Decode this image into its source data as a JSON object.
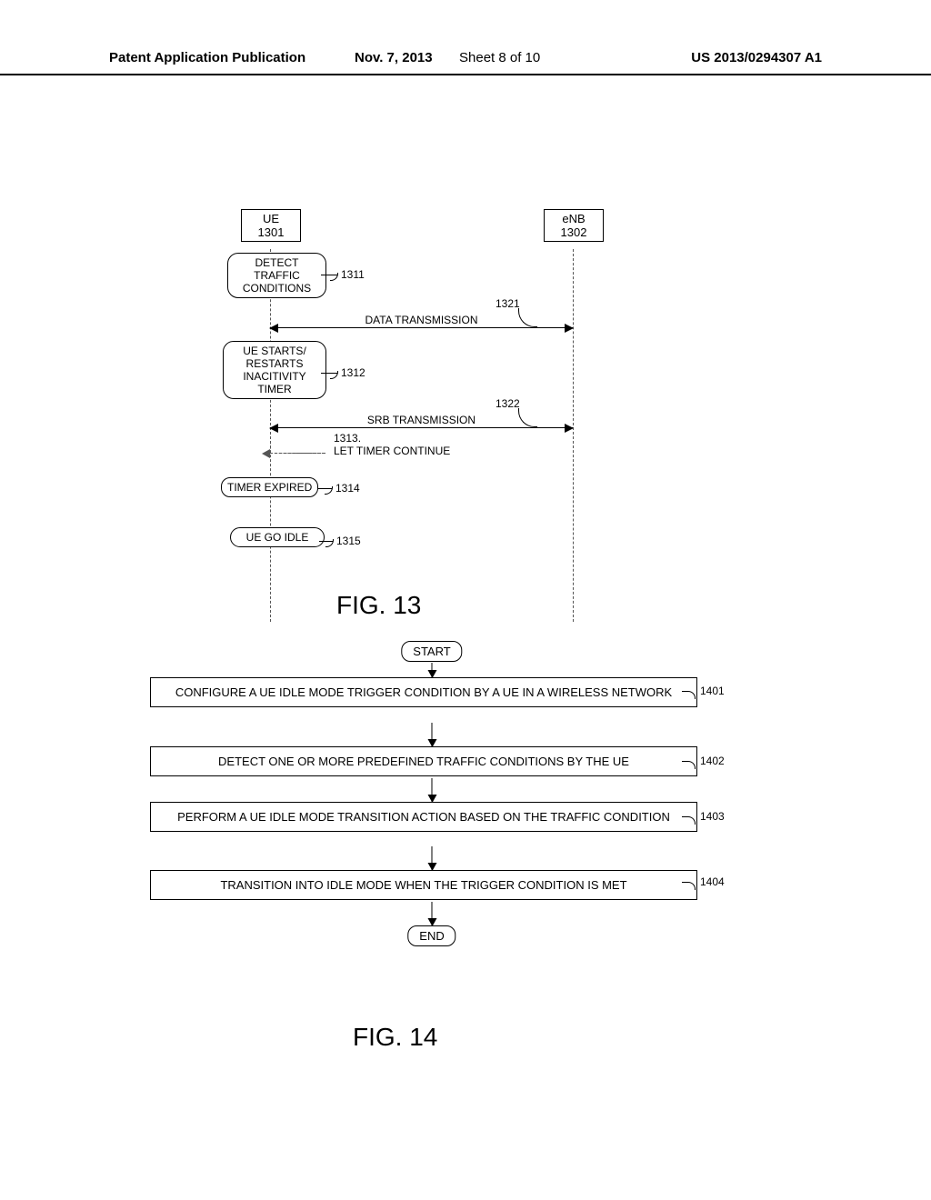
{
  "header": {
    "left": "Patent Application Publication",
    "mid_date": "Nov. 7, 2013",
    "sheet": "Sheet 8 of 10",
    "right": "US 2013/0294307 A1"
  },
  "fig13": {
    "caption": "FIG. 13",
    "actors": {
      "ue": "UE\n1301",
      "enb": "eNB\n1302"
    },
    "events": {
      "e1": "DETECT TRAFFIC CONDITIONS",
      "e2": "UE STARTS/ RESTARTS INACITIVITY TIMER",
      "e3_note": "1313.\nLET TIMER CONTINUE",
      "e4": "TIMER EXPIRED",
      "e5": "UE GO IDLE"
    },
    "event_refs": {
      "e1": "1311",
      "e2": "1312",
      "e4": "1314",
      "e5": "1315"
    },
    "messages": {
      "m1": {
        "label": "DATA TRANSMISSION",
        "ref": "1321"
      },
      "m2": {
        "label": "SRB TRANSMISSION",
        "ref": "1322"
      }
    }
  },
  "fig14": {
    "caption": "FIG. 14",
    "start": "START",
    "end": "END",
    "steps": {
      "s1": {
        "text": "CONFIGURE A UE IDLE MODE TRIGGER CONDITION BY A UE IN A WIRELESS NETWORK",
        "ref": "1401"
      },
      "s2": {
        "text": "DETECT ONE OR MORE PREDEFINED TRAFFIC CONDITIONS BY THE UE",
        "ref": "1402"
      },
      "s3": {
        "text": "PERFORM A UE IDLE MODE TRANSITION ACTION BASED ON THE TRAFFIC CONDITION",
        "ref": "1403"
      },
      "s4": {
        "text": "TRANSITION INTO IDLE MODE WHEN THE TRIGGER CONDITION IS MET",
        "ref": "1404"
      }
    }
  }
}
